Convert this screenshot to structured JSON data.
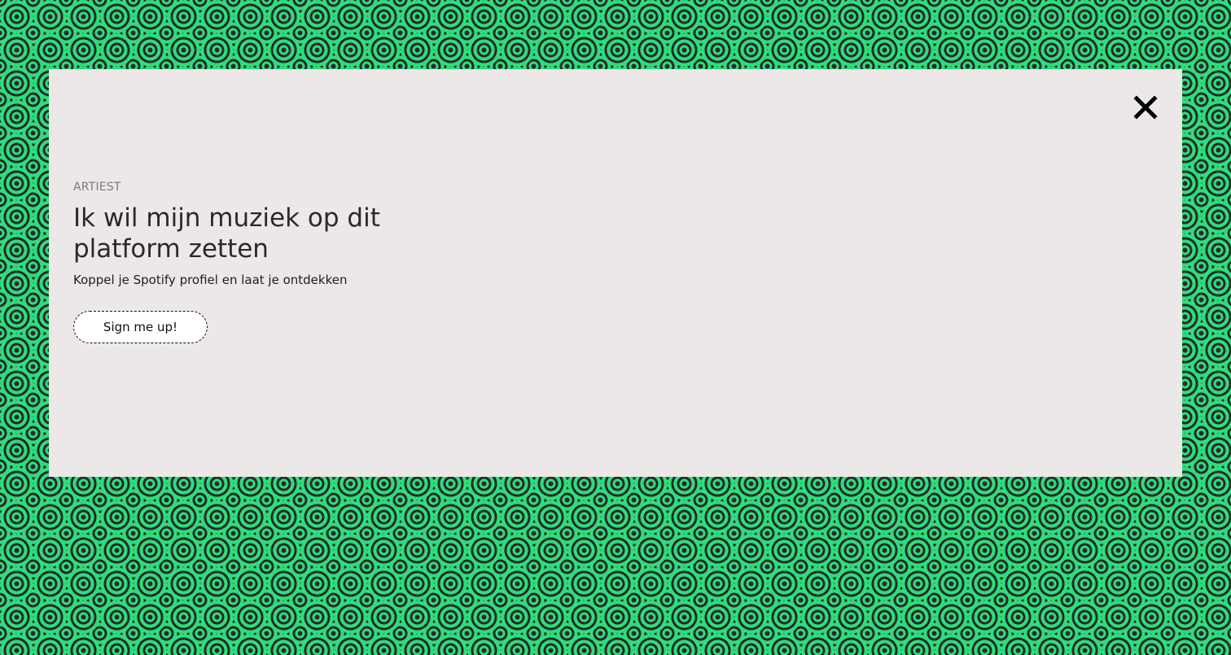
{
  "background": {
    "pattern": "concentric-circles",
    "colors": {
      "green": "#2cde7c",
      "dark": "#2a2a2a"
    }
  },
  "modal": {
    "background": "#ece8e7",
    "close_icon": "close-icon",
    "eyebrow": "ARTIEST",
    "headline": "Ik wil mijn muziek op dit platform zetten",
    "subtitle": "Koppel je Spotify profiel en laat je ontdekken",
    "cta_label": "Sign me up!"
  }
}
